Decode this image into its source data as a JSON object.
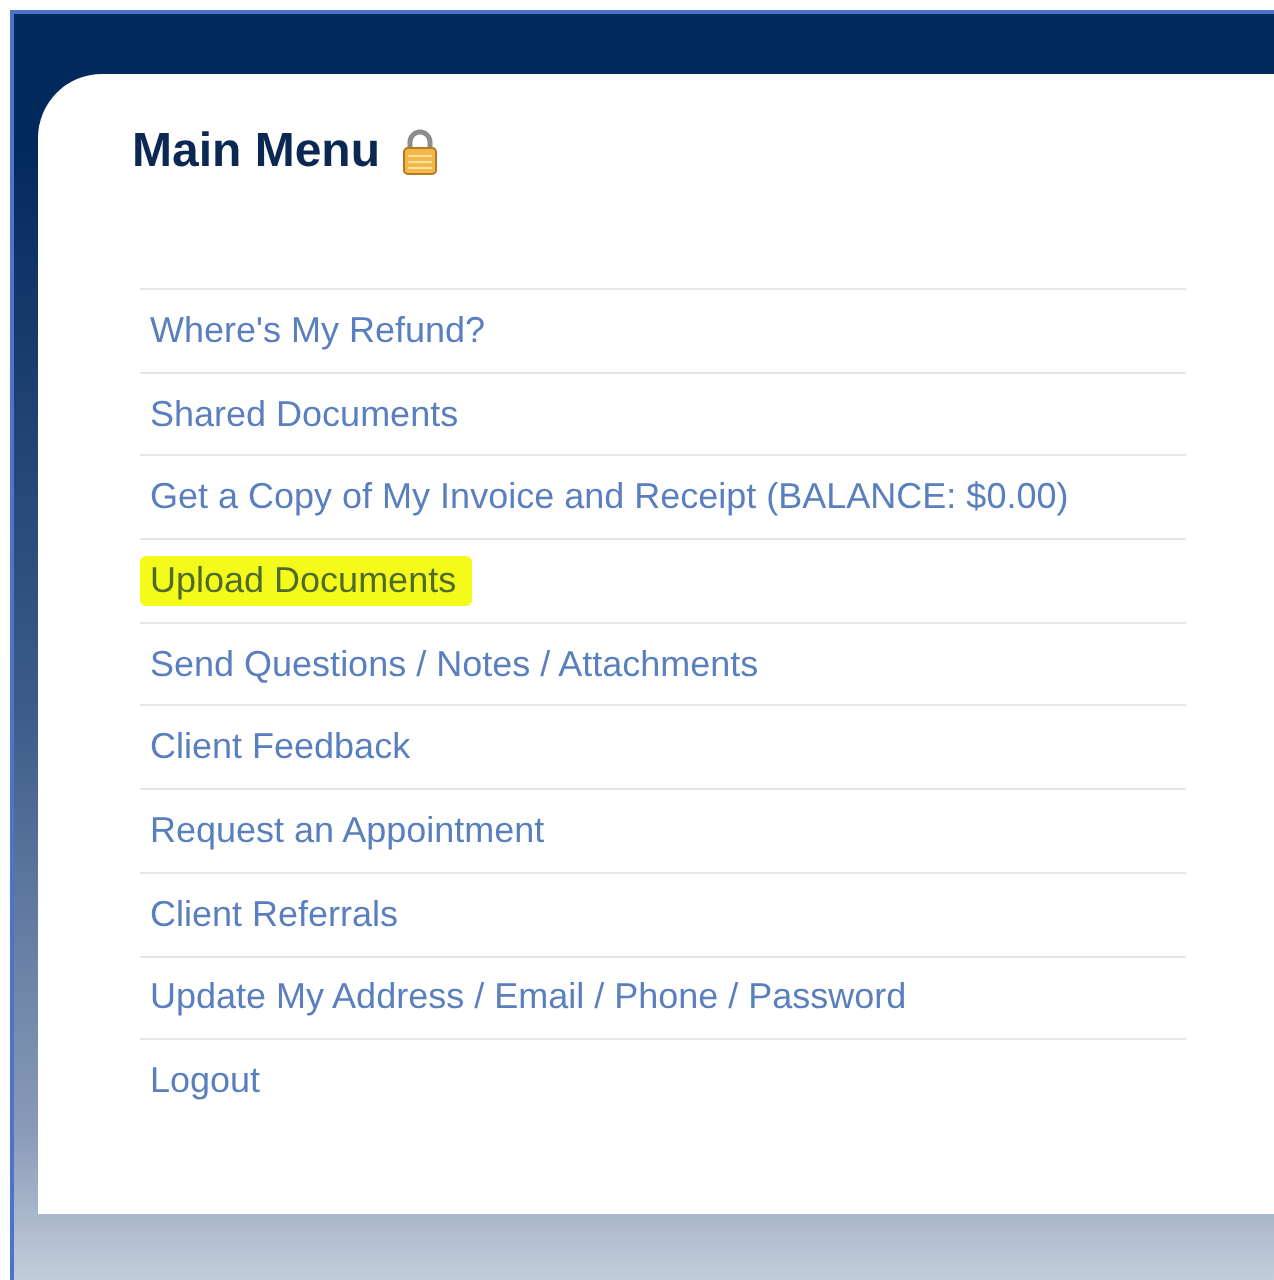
{
  "heading": "Main Menu",
  "menu_items": [
    {
      "label": "Where's My Refund?",
      "highlighted": false
    },
    {
      "label": "Shared Documents",
      "highlighted": false
    },
    {
      "label": "Get a Copy of My Invoice and Receipt (BALANCE: $0.00)",
      "highlighted": false
    },
    {
      "label": "Upload Documents",
      "highlighted": true
    },
    {
      "label": "Send Questions / Notes / Attachments",
      "highlighted": false
    },
    {
      "label": "Client Feedback",
      "highlighted": false
    },
    {
      "label": "Request an Appointment",
      "highlighted": false
    },
    {
      "label": "Client Referrals",
      "highlighted": false
    },
    {
      "label": "Update My Address / Email / Phone / Password",
      "highlighted": false
    },
    {
      "label": "Logout",
      "highlighted": false
    }
  ]
}
